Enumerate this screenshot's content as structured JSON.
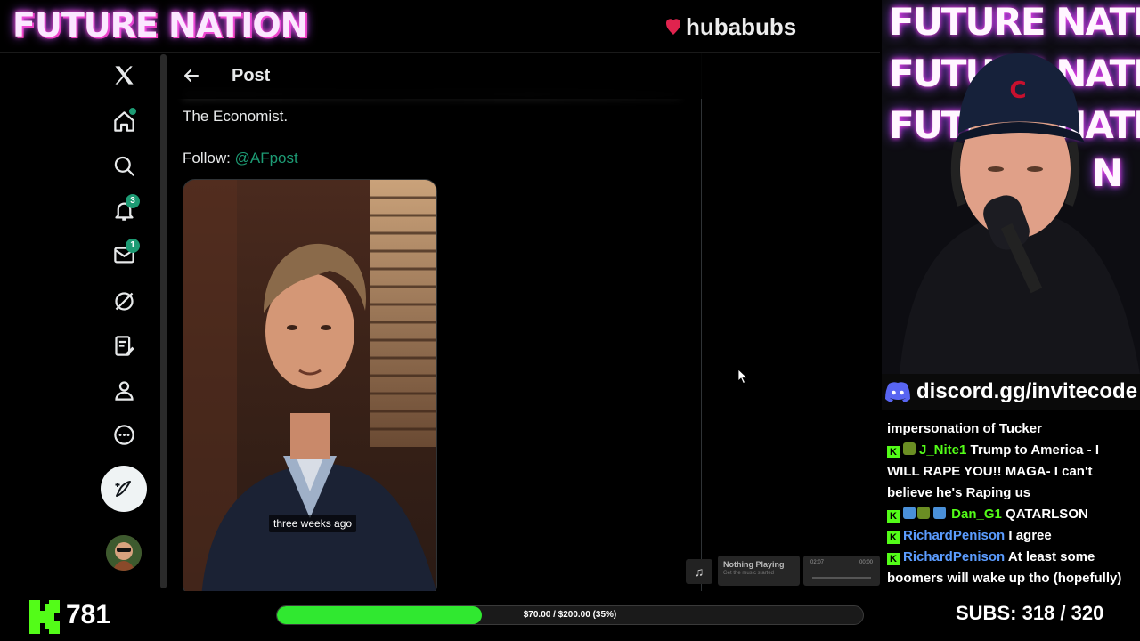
{
  "overlay": {
    "brand_title": "FUTURE NATION",
    "sponsor": "hubabubs",
    "neon_lines": [
      "FUTURE NATION",
      "FUTURE NATION",
      "FUTURE NATION",
      "N"
    ],
    "discord": "discord.gg/invitecode"
  },
  "x": {
    "header_title": "Post",
    "notifications_count": "3",
    "messages_count": "1",
    "post_text": "The Economist.",
    "follow_label": "Follow:",
    "follow_handle": "@AFpost",
    "video_caption": "three weeks ago"
  },
  "music": {
    "title": "Nothing Playing",
    "subtitle": "Get the music started",
    "time_elapsed": "02:07",
    "time_total": "00:00"
  },
  "chat": {
    "lines": [
      {
        "user": "",
        "text": "impersonation of Tucker"
      },
      {
        "user": "J_Nite1",
        "text": "Trump to America - I WILL RAPE YOU!! MAGA- I can't believe he's Raping us"
      },
      {
        "user": "Dan_G1",
        "text": "QATARLSON"
      },
      {
        "user": "RichardPenison",
        "text": "I agree"
      },
      {
        "user": "RichardPenison",
        "text": "At least some boomers will wake up tho (hopefully)"
      }
    ]
  },
  "bottom": {
    "followers": "781",
    "goal_text": "$70.00 / $200.00 (35%)",
    "goal_progress": 0.35,
    "subs_label": "SUBS:",
    "subs_value": "318 / 320"
  },
  "colors": {
    "accent_green": "#1d9b74",
    "kick_green": "#53fc18",
    "goal_green": "#30e830",
    "chat_blue": "#5b9cff"
  }
}
